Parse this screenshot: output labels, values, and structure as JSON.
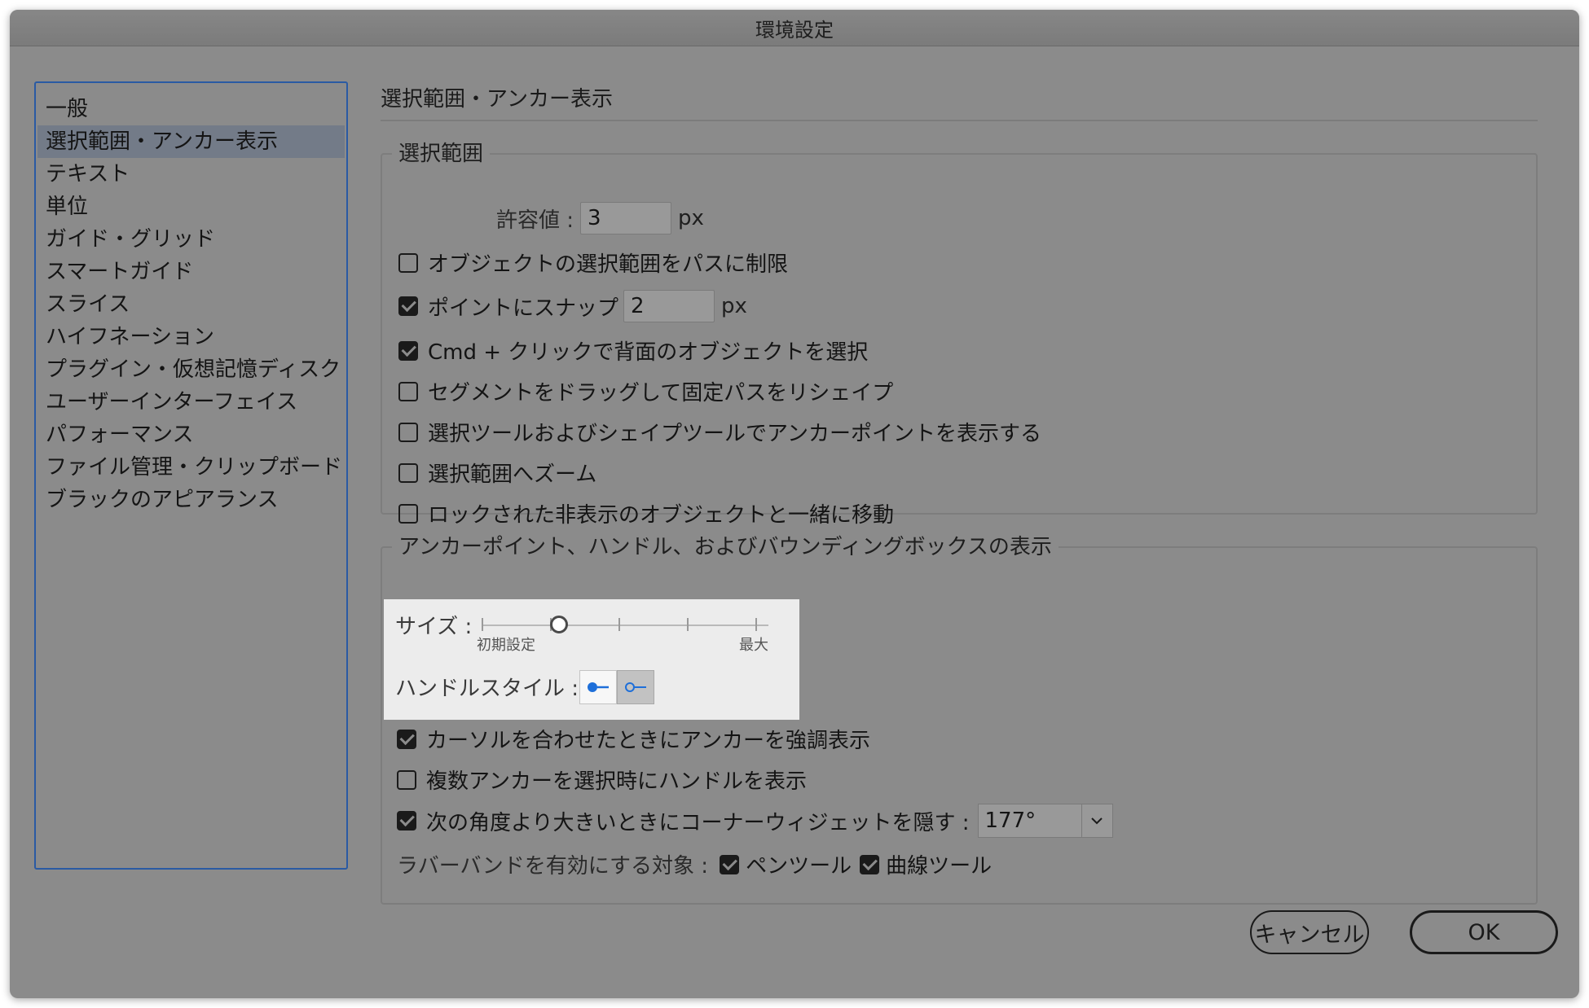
{
  "window": {
    "title": "環境設定"
  },
  "sidebar": {
    "items": [
      {
        "label": "一般"
      },
      {
        "label": "選択範囲・アンカー表示"
      },
      {
        "label": "テキスト"
      },
      {
        "label": "単位"
      },
      {
        "label": "ガイド・グリッド"
      },
      {
        "label": "スマートガイド"
      },
      {
        "label": "スライス"
      },
      {
        "label": "ハイフネーション"
      },
      {
        "label": "プラグイン・仮想記憶ディスク"
      },
      {
        "label": "ユーザーインターフェイス"
      },
      {
        "label": "パフォーマンス"
      },
      {
        "label": "ファイル管理・クリップボード"
      },
      {
        "label": "ブラックのアピアランス"
      }
    ],
    "selected_index": 1
  },
  "page": {
    "heading": "選択範囲・アンカー表示"
  },
  "selection": {
    "legend": "選択範囲",
    "tolerance_label": "許容値 :",
    "tolerance_value": "3",
    "tolerance_unit": "px",
    "restrict_to_paths": {
      "label": "オブジェクトの選択範囲をパスに制限",
      "checked": false
    },
    "snap_to_point": {
      "label": "ポイントにスナップ",
      "checked": true,
      "value": "2",
      "unit": "px"
    },
    "cmd_click": {
      "label": "Cmd + クリックで背面のオブジェクトを選択",
      "checked": true
    },
    "drag_segment": {
      "label": "セグメントをドラッグして固定パスをリシェイプ",
      "checked": false
    },
    "show_anchors": {
      "label": "選択ツールおよびシェイプツールでアンカーポイントを表示する",
      "checked": false
    },
    "zoom_to_selection": {
      "label": "選択範囲へズーム",
      "checked": false
    },
    "move_locked_hidden": {
      "label": "ロックされた非表示のオブジェクトと一緒に移動",
      "checked": false
    }
  },
  "anchor_display": {
    "legend": "アンカーポイント、ハンドル、およびバウンディングボックスの表示",
    "size_label": "サイズ :",
    "size_min_label": "初期設定",
    "size_max_label": "最大",
    "size_level": 0.25,
    "handle_style_label": "ハンドルスタイル :",
    "handle_style_selected": 1,
    "highlight_on_hover": {
      "label": "カーソルを合わせたときにアンカーを強調表示",
      "checked": true
    },
    "show_handles_multi": {
      "label": "複数アンカーを選択時にハンドルを表示",
      "checked": false
    },
    "hide_corner_widget": {
      "label": "次の角度より大きいときにコーナーウィジェットを隠す :",
      "checked": true,
      "value": "177°"
    },
    "rubber_band_label": "ラバーバンドを有効にする対象 :",
    "pen_tool": {
      "label": "ペンツール",
      "checked": true
    },
    "curvature_tool": {
      "label": "曲線ツール",
      "checked": true
    }
  },
  "buttons": {
    "cancel": "キャンセル",
    "ok": "OK"
  },
  "colors": {
    "window_bg": "#8b8b8b",
    "sidebar_border": "#2a5aa3",
    "selected_item_bg": "#737b88",
    "handle_blue": "#1e6fd9"
  }
}
